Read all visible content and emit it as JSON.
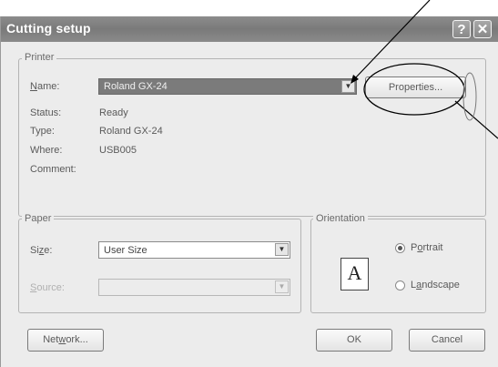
{
  "window": {
    "title": "Cutting setup",
    "help_glyph": "?",
    "close_glyph": "✕"
  },
  "printer": {
    "legend": "Printer",
    "name_label": "Name:",
    "name_value": "Roland GX-24",
    "properties_button": "Properties...",
    "status_label": "Status:",
    "status_value": "Ready",
    "type_label": "Type:",
    "type_value": "Roland GX-24",
    "where_label": "Where:",
    "where_value": "USB005",
    "comment_label": "Comment:",
    "comment_value": ""
  },
  "paper": {
    "legend": "Paper",
    "size_label": "Size:",
    "size_value": "User Size",
    "source_label": "Source:",
    "source_value": ""
  },
  "orientation": {
    "legend": "Orientation",
    "preview_letter": "A",
    "portrait_label": "Portrait",
    "landscape_label": "Landscape",
    "selected": "Portrait"
  },
  "buttons": {
    "network": "Network...",
    "ok": "OK",
    "cancel": "Cancel"
  },
  "colors": {
    "titlebar": "#808080",
    "dialog_bg": "#ececec",
    "selected_field": "#7b7b7b"
  }
}
